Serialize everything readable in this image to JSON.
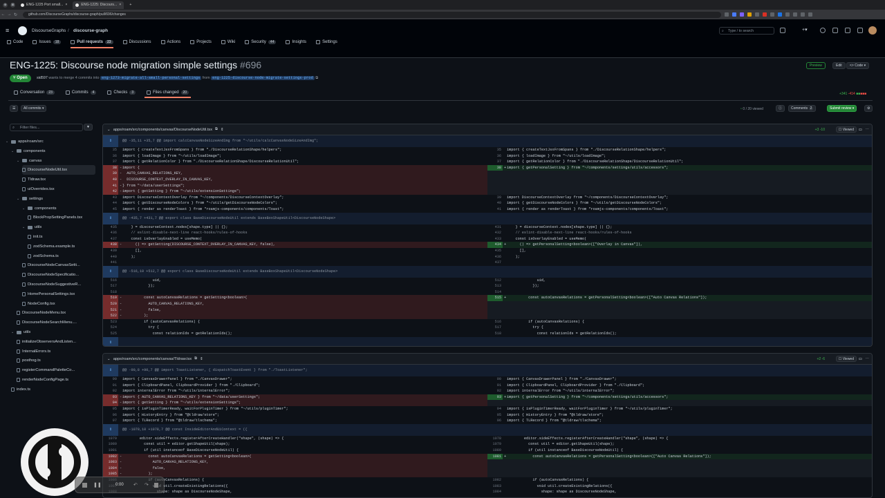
{
  "browser": {
    "tabs": [
      "ENG-1225 Port small...",
      "ENG-1225: Discours..."
    ],
    "url": "github.com/DiscourseGraphs/discourse-graph/pull/696/changes"
  },
  "header": {
    "org": "DiscourseGraphs",
    "repo": "discourse-graph",
    "search_placeholder": "Type / to search",
    "tabs": [
      {
        "label": "Code",
        "count": ""
      },
      {
        "label": "Issues",
        "count": "18"
      },
      {
        "label": "Pull requests",
        "count": "23"
      },
      {
        "label": "Discussions",
        "count": ""
      },
      {
        "label": "Actions",
        "count": ""
      },
      {
        "label": "Projects",
        "count": ""
      },
      {
        "label": "Wiki",
        "count": ""
      },
      {
        "label": "Security",
        "count": "44"
      },
      {
        "label": "Insights",
        "count": ""
      },
      {
        "label": "Settings",
        "count": ""
      }
    ]
  },
  "pr": {
    "title": "ENG-1225: Discourse node migration simple settings",
    "number": "#696",
    "state": "Open",
    "author": "sid597",
    "merge_text": "wants to merge 4 commits into",
    "base": "eng-1273-migrate-all-small-personal-settings",
    "from": "from",
    "head": "eng-1225-discourse-node-migrate-settings-prod",
    "preview": "Preview",
    "edit": "Edit",
    "code": "Code",
    "additions": "+341",
    "deletions": "-414",
    "tabs": [
      {
        "label": "Conversation",
        "count": "23"
      },
      {
        "label": "Commits",
        "count": "4"
      },
      {
        "label": "Checks",
        "count": "3"
      },
      {
        "label": "Files changed",
        "count": "20"
      }
    ]
  },
  "toolbar": {
    "all_commits": "All commits",
    "viewed": "0 / 20 viewed",
    "comments": "Comments",
    "comments_count": "2",
    "submit": "Submit review"
  },
  "tree": {
    "filter_placeholder": "Filter files...",
    "items": [
      {
        "label": "apps/roam/src",
        "type": "folder"
      },
      {
        "label": "components",
        "type": "folder"
      },
      {
        "label": "canvas",
        "type": "folder"
      },
      {
        "label": "DiscourseNodeUtil.tsx",
        "type": "file"
      },
      {
        "label": "Tldraw.tsx",
        "type": "file"
      },
      {
        "label": "uiOverrides.tsx",
        "type": "file"
      },
      {
        "label": "settings",
        "type": "folder"
      },
      {
        "label": "components",
        "type": "folder"
      },
      {
        "label": "BlockPropSettingPanels.tsx",
        "type": "file"
      },
      {
        "label": "utils",
        "type": "folder"
      },
      {
        "label": "init.ts",
        "type": "file"
      },
      {
        "label": "zodSchema.example.ts",
        "type": "file"
      },
      {
        "label": "zodSchema.ts",
        "type": "file"
      },
      {
        "label": "DiscourseNodeCanvasSetti...",
        "type": "file"
      },
      {
        "label": "DiscourseNodeSpecificatio...",
        "type": "file"
      },
      {
        "label": "DiscourseNodeSuggestiveR...",
        "type": "file"
      },
      {
        "label": "HomePersonalSettings.tsx",
        "type": "file"
      },
      {
        "label": "NodeConfig.tsx",
        "type": "file"
      },
      {
        "label": "DiscourseNodeMenu.tsx",
        "type": "file"
      },
      {
        "label": "DiscourseNodeSearchMenu....",
        "type": "file"
      },
      {
        "label": "utils",
        "type": "folder"
      },
      {
        "label": "initializeObserversAndListen...",
        "type": "file"
      },
      {
        "label": "InternalErrors.ts",
        "type": "file"
      },
      {
        "label": "posthog.ts",
        "type": "file"
      },
      {
        "label": "registerCommandPaletteCo...",
        "type": "file"
      },
      {
        "label": "renderNodeConfigPage.ts",
        "type": "file"
      },
      {
        "label": "index.ts",
        "type": "file"
      }
    ]
  },
  "files": [
    {
      "path": "apps/roam/src/components/canvas/DiscourseNodeUtil.tsx",
      "stat": "+3 -10",
      "viewed_label": "Viewed",
      "rows": [
        {
          "t": "hunk",
          "text": "@@ -35,11 +35,7 @@ import calcCanvasNodeSizeAndImg from \"~/utils/calcCanvasNodeSizeAndImg\";"
        },
        {
          "t": "ctx",
          "ln": "35",
          "rn": "35",
          "l": "import { createTextJsxFromSpans } from \"./DiscourseRelationShape/helpers\";",
          "r": "import { createTextJsxFromSpans } from \"./DiscourseRelationShape/helpers\";"
        },
        {
          "t": "ctx",
          "ln": "36",
          "rn": "36",
          "l": "import { loadImage } from \"~/utils/loadImage\";",
          "r": "import { loadImage } from \"~/utils/loadImage\";"
        },
        {
          "t": "ctx",
          "ln": "37",
          "rn": "37",
          "l": "import { getRelationColor } from \"./DiscourseRelationShape/DiscourseRelationUtil\";",
          "r": "import { getRelationColor } from \"./DiscourseRelationShape/DiscourseRelationUtil\";"
        },
        {
          "t": "chg",
          "ln": "38",
          "rn": "38",
          "l": "import {",
          "r": "import { getPersonalSetting } from \"~/components/settings/utils/accessors\";"
        },
        {
          "t": "del",
          "ln": "39",
          "l": "  AUTO_CANVAS_RELATIONS_KEY,"
        },
        {
          "t": "del",
          "ln": "40",
          "l": "  DISCOURSE_CONTEXT_OVERLAY_IN_CANVAS_KEY,"
        },
        {
          "t": "del",
          "ln": "41",
          "l": "} from \"~/data/userSettings\";"
        },
        {
          "t": "del",
          "ln": "42",
          "l": "import { getSetting } from \"~/utils/extensionSettings\";"
        },
        {
          "t": "ctx",
          "ln": "43",
          "rn": "39",
          "l": "import DiscourseContextOverlay from \"~/components/DiscourseContextOverlay\";",
          "r": "import DiscourseContextOverlay from \"~/components/DiscourseContextOverlay\";"
        },
        {
          "t": "ctx",
          "ln": "44",
          "rn": "40",
          "l": "import { getDiscourseNodeColors } from \"~/utils/getDiscourseNodeColors\";",
          "r": "import { getDiscourseNodeColors } from \"~/utils/getDiscourseNodeColors\";"
        },
        {
          "t": "ctx",
          "ln": "45",
          "rn": "41",
          "l": "import { render as renderToast } from \"roamjs-components/components/Toast\";",
          "r": "import { render as renderToast } from \"roamjs-components/components/Toast\";"
        },
        {
          "t": "hunk",
          "text": "@@ -435,7 +431,7 @@ export class BaseDiscourseNodeUtil extends BaseBoxShapeUtil<DiscourseNodeShape>"
        },
        {
          "t": "ctx",
          "ln": "435",
          "rn": "431",
          "l": "    } = discourseContext.nodes[shape.type] || {};",
          "r": "    } = discourseContext.nodes[shape.type] || {};"
        },
        {
          "t": "ctx",
          "ln": "436",
          "rn": "432",
          "l": "    // eslint-disable-next-line react-hooks/rules-of-hooks",
          "r": "    // eslint-disable-next-line react-hooks/rules-of-hooks"
        },
        {
          "t": "ctx",
          "ln": "437",
          "rn": "433",
          "l": "    const isOverlayEnabled = useMemo(",
          "r": "    const isOverlayEnabled = useMemo("
        },
        {
          "t": "chg",
          "ln": "438",
          "rn": "434",
          "l": "      () => getSetting(DISCOURSE_CONTEXT_OVERLAY_IN_CANVAS_KEY, false),",
          "r": "      () => getPersonalSetting<boolean>([\"Overlay in Canvas\"]),"
        },
        {
          "t": "ctx",
          "ln": "439",
          "rn": "435",
          "l": "      [],",
          "r": "      [],"
        },
        {
          "t": "ctx",
          "ln": "440",
          "rn": "436",
          "l": "    );",
          "r": "    );"
        },
        {
          "t": "ctx",
          "ln": "441",
          "rn": "437",
          "l": "",
          "r": ""
        },
        {
          "t": "hunk",
          "text": "@@ -516,10 +512,7 @@ export class BaseDiscourseNodeUtil extends BaseBoxShapeUtil<DiscourseNodeShape>"
        },
        {
          "t": "ctx",
          "ln": "516",
          "rn": "512",
          "l": "              uid,",
          "r": "              uid,"
        },
        {
          "t": "ctx",
          "ln": "517",
          "rn": "513",
          "l": "            });",
          "r": "            });"
        },
        {
          "t": "ctx",
          "ln": "518",
          "rn": "514",
          "l": "",
          "r": ""
        },
        {
          "t": "chg",
          "ln": "519",
          "rn": "515",
          "l": "          const autoCanvasRelations = getSetting<boolean>(",
          "r": "          const autoCanvasRelations = getPersonalSetting<boolean>([\"Auto Canvas Relations\"]);"
        },
        {
          "t": "del",
          "ln": "520",
          "l": "            AUTO_CANVAS_RELATIONS_KEY,"
        },
        {
          "t": "del",
          "ln": "521",
          "l": "            false,"
        },
        {
          "t": "del",
          "ln": "522",
          "l": "          );"
        },
        {
          "t": "ctx",
          "ln": "523",
          "rn": "516",
          "l": "          if (autoCanvasRelations) {",
          "r": "          if (autoCanvasRelations) {"
        },
        {
          "t": "ctx",
          "ln": "524",
          "rn": "517",
          "l": "            try {",
          "r": "            try {"
        },
        {
          "t": "ctx",
          "ln": "525",
          "rn": "518",
          "l": "              const relationIds = getRelationIds();",
          "r": "              const relationIds = getRelationIds();"
        },
        {
          "t": "hunk",
          "text": ""
        }
      ]
    },
    {
      "path": "apps/roam/src/components/canvas/Tldraw.tsx",
      "stat": "+2 -6",
      "viewed_label": "Viewed",
      "rows": [
        {
          "t": "hunk",
          "text": "@@ -90,8 +90,7 @@ import ToastListener, { dispatchToastEvent } from \"./ToastListener\";"
        },
        {
          "t": "ctx",
          "ln": "90",
          "rn": "90",
          "l": "import { CanvasDrawerPanel } from \"./CanvasDrawer\";",
          "r": "import { CanvasDrawerPanel } from \"./CanvasDrawer\";"
        },
        {
          "t": "ctx",
          "ln": "91",
          "rn": "91",
          "l": "import { ClipboardPanel, ClipboardProvider } from \"./Clipboard\";",
          "r": "import { ClipboardPanel, ClipboardProvider } from \"./Clipboard\";"
        },
        {
          "t": "ctx",
          "ln": "92",
          "rn": "92",
          "l": "import internalError from \"~/utils/internalError\";",
          "r": "import internalError from \"~/utils/internalError\";"
        },
        {
          "t": "chg",
          "ln": "93",
          "rn": "93",
          "l": "import { AUTO_CANVAS_RELATIONS_KEY } from \"~/data/userSettings\";",
          "r": "import { getPersonalSetting } from \"~/components/settings/utils/accessors\";"
        },
        {
          "t": "del",
          "ln": "94",
          "l": "import { getSetting } from \"~/utils/extensionSettings\";"
        },
        {
          "t": "ctx",
          "ln": "95",
          "rn": "94",
          "l": "import { isPluginTimerReady, waitForPluginTimer } from \"~/utils/pluginTimer\";",
          "r": "import { isPluginTimerReady, waitForPluginTimer } from \"~/utils/pluginTimer\";"
        },
        {
          "t": "ctx",
          "ln": "96",
          "rn": "95",
          "l": "import { HistoryEntry } from \"@tldraw/store\";",
          "r": "import { HistoryEntry } from \"@tldraw/store\";"
        },
        {
          "t": "ctx",
          "ln": "97",
          "rn": "96",
          "l": "import { TLRecord } from \"@tldraw/tlschema\";",
          "r": "import { TLRecord } from \"@tldraw/tlschema\";"
        },
        {
          "t": "hunk",
          "text": "@@ -1079,10 +1078,7 @@ const InsideEditorAndUiContext = ({"
        },
        {
          "t": "ctx",
          "ln": "1079",
          "rn": "1078",
          "l": "        editor.sideEffects.registerAfterCreateHandler(\"shape\", (shape) => {",
          "r": "        editor.sideEffects.registerAfterCreateHandler(\"shape\", (shape) => {"
        },
        {
          "t": "ctx",
          "ln": "1080",
          "rn": "1079",
          "l": "          const util = editor.getShapeUtil(shape);",
          "r": "          const util = editor.getShapeUtil(shape);"
        },
        {
          "t": "ctx",
          "ln": "1081",
          "rn": "1080",
          "l": "          if (util instanceof BaseDiscourseNodeUtil) {",
          "r": "          if (util instanceof BaseDiscourseNodeUtil) {"
        },
        {
          "t": "chg",
          "ln": "1082",
          "rn": "1081",
          "l": "            const autoCanvasRelations = getSetting<boolean>(",
          "r": "            const autoCanvasRelations = getPersonalSetting<boolean>([\"Auto Canvas Relations\"]);"
        },
        {
          "t": "del",
          "ln": "1083",
          "l": "              AUTO_CANVAS_RELATIONS_KEY,"
        },
        {
          "t": "del",
          "ln": "1084",
          "l": "              false,"
        },
        {
          "t": "del",
          "ln": "1085",
          "l": "            );"
        },
        {
          "t": "ctx",
          "ln": "1086",
          "rn": "1082",
          "l": "            if (autoCanvasRelations) {",
          "r": "            if (autoCanvasRelations) {"
        },
        {
          "t": "ctx",
          "ln": "1087",
          "rn": "1083",
          "l": "              void util.createExistingRelations({",
          "r": "              void util.createExistingRelations({"
        },
        {
          "t": "ctx",
          "ln": "1088",
          "rn": "1084",
          "l": "                shape: shape as DiscourseNodeShape,",
          "r": "                shape: shape as DiscourseNodeShape,"
        }
      ]
    }
  ],
  "player": {
    "time": "0:00"
  }
}
